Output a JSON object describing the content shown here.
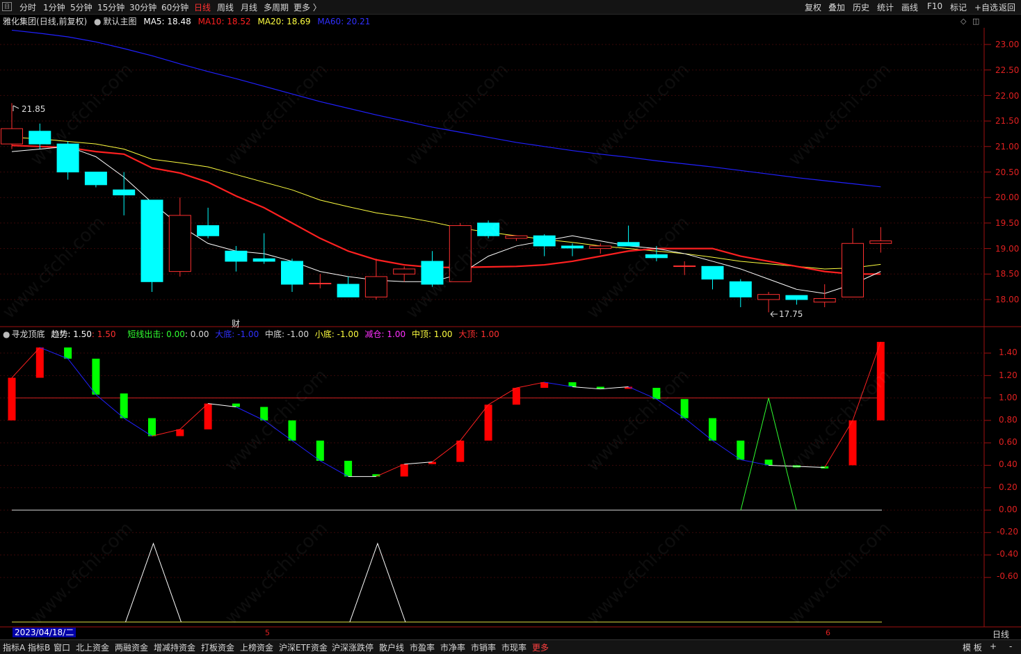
{
  "toolbar": {
    "icon_label": "日",
    "left": [
      "分时",
      "1分钟",
      "5分钟",
      "15分钟",
      "30分钟",
      "60分钟",
      "日线",
      "周线",
      "月线",
      "多周期",
      "更多 〉"
    ],
    "active": "日线",
    "right": [
      "复权",
      "叠加",
      "历史",
      "统计",
      "画线",
      "F10",
      "标记",
      "+自选",
      "返回"
    ]
  },
  "main_info": {
    "stock": "雅化集团",
    "mode": "(日线,前复权)",
    "template": "默认主图",
    "ma5": "MA5: 18.48",
    "ma10": "MA10: 18.52",
    "ma20": "MA20: 18.69",
    "ma60": "MA60: 20.21"
  },
  "indicator_info": {
    "name": "寻龙顶底",
    "trend_label": "趋势: 1.50",
    "trend_value": ": 1.50",
    "short_exit": "短线出击: 0.00",
    "short_exit_value": ": 0.00",
    "big_bottom": "大底: -1.00",
    "mid_bottom": "中底: -1.00",
    "small_bottom": "小底: -1.00",
    "reduce": "减仓: 1.00",
    "mid_top": "中顶: 1.00",
    "big_top": "大顶: 1.00"
  },
  "annotations": {
    "high": "21.85",
    "low": "17.75",
    "finance_marker": "财"
  },
  "price_axis": [
    "23.00",
    "22.50",
    "22.00",
    "21.50",
    "21.00",
    "20.50",
    "20.00",
    "19.50",
    "19.00",
    "18.50",
    "18.00"
  ],
  "indicator_axis": [
    "1.40",
    "1.20",
    "1.00",
    "0.80",
    "0.60",
    "0.40",
    "0.20",
    "0.00",
    "-0.20",
    "-0.40",
    "-0.60"
  ],
  "date_label": "2023/04/18/二",
  "month_ticks": [
    "5",
    "6"
  ],
  "period_label": "日线",
  "bottom_tabs": [
    "指标A",
    "指标B",
    "窗口",
    "北上资金",
    "两融资金",
    "增减持资金",
    "打板资金",
    "上榜资金",
    "沪深ETF资金",
    "沪深涨跌停",
    "散户线",
    "市盈率",
    "市净率",
    "市销率",
    "市现率",
    "更多"
  ],
  "bottom_right": [
    "模 板",
    "+",
    "-"
  ],
  "watermark": "www.cfchi.com",
  "colors": {
    "up": "#ff3030",
    "down": "#00ffff",
    "ma5": "#ffffff",
    "ma10": "#ff2020",
    "ma20": "#ffff40",
    "ma60": "#2020ff",
    "ind_up": "#ff0000",
    "ind_down": "#00ff00"
  },
  "chart_data": [
    {
      "type": "candlestick",
      "title": "雅化集团 (日线,前复权)",
      "ylim": [
        17.5,
        23.3
      ],
      "candles": [
        {
          "o": 21.05,
          "c": 21.35,
          "h": 21.85,
          "l": 20.95
        },
        {
          "o": 21.3,
          "c": 21.05,
          "h": 21.45,
          "l": 20.95
        },
        {
          "o": 21.05,
          "c": 20.5,
          "h": 21.1,
          "l": 20.35
        },
        {
          "o": 20.5,
          "c": 20.25,
          "h": 20.5,
          "l": 20.2
        },
        {
          "o": 20.15,
          "c": 20.05,
          "h": 20.5,
          "l": 19.65
        },
        {
          "o": 19.95,
          "c": 18.35,
          "h": 19.95,
          "l": 18.15
        },
        {
          "o": 18.55,
          "c": 19.65,
          "h": 20.0,
          "l": 18.45
        },
        {
          "o": 19.45,
          "c": 19.25,
          "h": 19.8,
          "l": 19.2
        },
        {
          "o": 18.95,
          "c": 18.75,
          "h": 19.05,
          "l": 18.55
        },
        {
          "o": 18.8,
          "c": 18.75,
          "h": 19.3,
          "l": 18.7
        },
        {
          "o": 18.75,
          "c": 18.3,
          "h": 18.8,
          "l": 18.15
        },
        {
          "o": 18.32,
          "c": 18.32,
          "h": 18.5,
          "l": 18.22
        },
        {
          "o": 18.3,
          "c": 18.05,
          "h": 18.45,
          "l": 18.05
        },
        {
          "o": 18.05,
          "c": 18.45,
          "h": 18.8,
          "l": 18.0
        },
        {
          "o": 18.5,
          "c": 18.6,
          "h": 18.65,
          "l": 18.35
        },
        {
          "o": 18.75,
          "c": 18.3,
          "h": 18.95,
          "l": 18.25
        },
        {
          "o": 18.35,
          "c": 19.45,
          "h": 19.5,
          "l": 18.35
        },
        {
          "o": 19.5,
          "c": 19.25,
          "h": 19.55,
          "l": 19.2
        },
        {
          "o": 19.2,
          "c": 19.25,
          "h": 19.25,
          "l": 19.15
        },
        {
          "o": 19.25,
          "c": 19.05,
          "h": 19.28,
          "l": 18.85
        },
        {
          "o": 19.05,
          "c": 19.01,
          "h": 19.1,
          "l": 18.85
        },
        {
          "o": 19.0,
          "c": 19.05,
          "h": 19.1,
          "l": 18.9
        },
        {
          "o": 19.12,
          "c": 19.05,
          "h": 19.45,
          "l": 19.05
        },
        {
          "o": 18.88,
          "c": 18.82,
          "h": 19.05,
          "l": 18.75
        },
        {
          "o": 18.65,
          "c": 18.66,
          "h": 18.75,
          "l": 18.48
        },
        {
          "o": 18.65,
          "c": 18.4,
          "h": 18.65,
          "l": 18.2
        },
        {
          "o": 18.35,
          "c": 18.05,
          "h": 18.4,
          "l": 17.85
        },
        {
          "o": 18.0,
          "c": 18.1,
          "h": 18.15,
          "l": 17.75
        },
        {
          "o": 18.08,
          "c": 18.0,
          "h": 18.08,
          "l": 17.9
        },
        {
          "o": 17.95,
          "c": 18.02,
          "h": 18.3,
          "l": 17.85
        },
        {
          "o": 18.05,
          "c": 19.1,
          "h": 19.4,
          "l": 18.05
        },
        {
          "o": 19.1,
          "c": 19.15,
          "h": 19.42,
          "l": 18.92
        }
      ],
      "ma5": [
        20.9,
        20.95,
        21.0,
        20.8,
        20.4,
        19.9,
        19.45,
        19.1,
        18.95,
        18.9,
        18.75,
        18.55,
        18.45,
        18.38,
        18.35,
        18.35,
        18.5,
        18.85,
        19.05,
        19.15,
        19.25,
        19.15,
        19.05,
        19.0,
        18.9,
        18.75,
        18.6,
        18.4,
        18.2,
        18.12,
        18.3,
        18.55
      ],
      "ma10": [
        21.02,
        21.0,
        20.98,
        20.9,
        20.85,
        20.58,
        20.48,
        20.3,
        20.03,
        19.8,
        19.5,
        19.2,
        18.95,
        18.78,
        18.68,
        18.63,
        18.63,
        18.64,
        18.65,
        18.68,
        18.75,
        18.85,
        18.95,
        19.0,
        19.0,
        19.0,
        18.85,
        18.75,
        18.65,
        18.55,
        18.5,
        18.5
      ],
      "ma20": [
        21.18,
        21.15,
        21.1,
        21.05,
        20.95,
        20.75,
        20.68,
        20.6,
        20.45,
        20.3,
        20.15,
        19.95,
        19.82,
        19.7,
        19.62,
        19.52,
        19.4,
        19.32,
        19.25,
        19.18,
        19.12,
        19.05,
        19.0,
        18.95,
        18.9,
        18.83,
        18.75,
        18.7,
        18.65,
        18.6,
        18.62,
        18.69
      ],
      "ma60": [
        23.28,
        23.22,
        23.15,
        23.05,
        22.92,
        22.78,
        22.62,
        22.47,
        22.33,
        22.18,
        22.03,
        21.88,
        21.75,
        21.62,
        21.5,
        21.38,
        21.28,
        21.18,
        21.08,
        21.0,
        20.92,
        20.85,
        20.79,
        20.72,
        20.66,
        20.6,
        20.53,
        20.46,
        20.39,
        20.33,
        20.27,
        20.21
      ]
    },
    {
      "type": "bar",
      "title": "寻龙顶底",
      "ylim": [
        -0.75,
        1.55
      ],
      "trend": [
        {
          "o": 0.8,
          "c": 1.18
        },
        {
          "o": 1.18,
          "c": 1.45
        },
        {
          "o": 1.45,
          "c": 1.35
        },
        {
          "o": 1.35,
          "c": 1.03
        },
        {
          "o": 1.04,
          "c": 0.82
        },
        {
          "o": 0.82,
          "c": 0.66
        },
        {
          "o": 0.66,
          "c": 0.72
        },
        {
          "o": 0.72,
          "c": 0.95
        },
        {
          "o": 0.95,
          "c": 0.92
        },
        {
          "o": 0.92,
          "c": 0.8
        },
        {
          "o": 0.8,
          "c": 0.62
        },
        {
          "o": 0.62,
          "c": 0.44
        },
        {
          "o": 0.44,
          "c": 0.3
        },
        {
          "o": 0.32,
          "c": 0.3
        },
        {
          "o": 0.3,
          "c": 0.41
        },
        {
          "o": 0.41,
          "c": 0.43
        },
        {
          "o": 0.43,
          "c": 0.62
        },
        {
          "o": 0.62,
          "c": 0.94
        },
        {
          "o": 0.94,
          "c": 1.09
        },
        {
          "o": 1.09,
          "c": 1.14
        },
        {
          "o": 1.14,
          "c": 1.1
        },
        {
          "o": 1.1,
          "c": 1.08
        },
        {
          "o": 1.09,
          "c": 1.1
        },
        {
          "o": 1.09,
          "c": 0.99
        },
        {
          "o": 0.99,
          "c": 0.82
        },
        {
          "o": 0.82,
          "c": 0.62
        },
        {
          "o": 0.62,
          "c": 0.45
        },
        {
          "o": 0.45,
          "c": 0.4
        },
        {
          "o": 0.4,
          "c": 0.39
        },
        {
          "o": 0.39,
          "c": 0.38
        },
        {
          "o": 0.4,
          "c": 0.8
        },
        {
          "o": 0.8,
          "c": 1.5
        }
      ],
      "short_exit": [
        0,
        0,
        0,
        0,
        0,
        0,
        0,
        0,
        0,
        0,
        0,
        0,
        0,
        0,
        0,
        0,
        0,
        0,
        0,
        0,
        0,
        0,
        0,
        0,
        0,
        0,
        0,
        1,
        0,
        0,
        0,
        0
      ],
      "bottom_signal": [
        0,
        0,
        0,
        0,
        0,
        1,
        0,
        0,
        0,
        0,
        0,
        0,
        0,
        1,
        0,
        0,
        0,
        0,
        0,
        0,
        0,
        0,
        0,
        0,
        0,
        0,
        0,
        0,
        0,
        0,
        0,
        0
      ]
    }
  ]
}
